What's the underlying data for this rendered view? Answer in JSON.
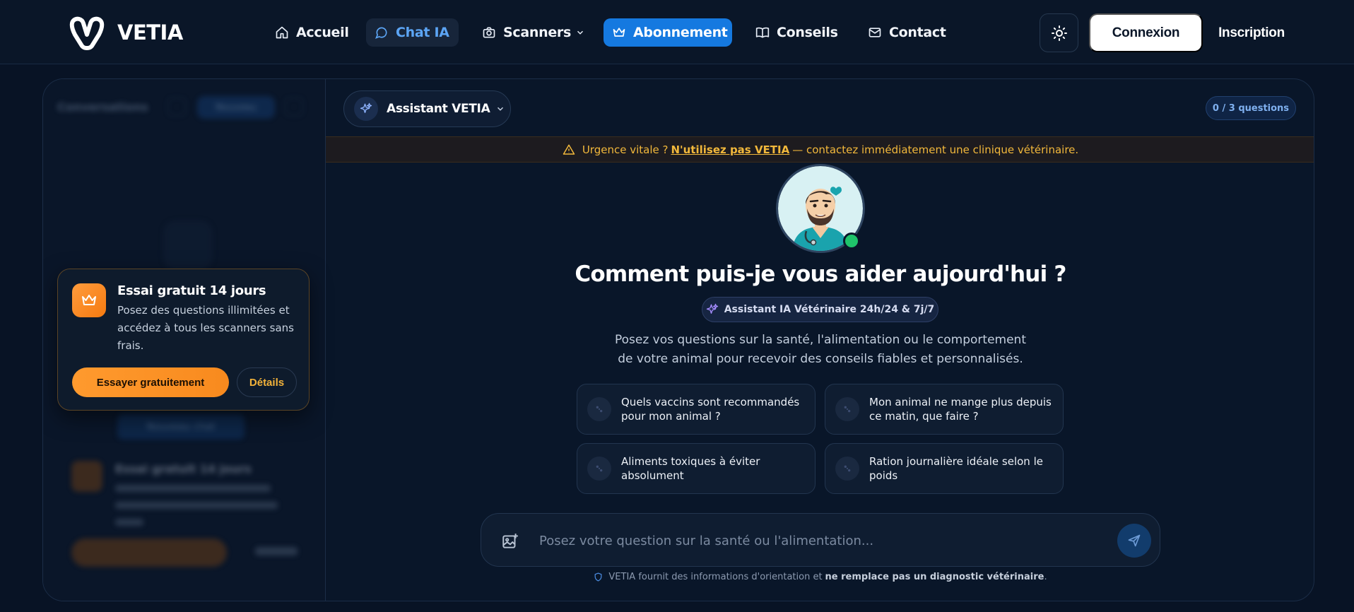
{
  "brand": {
    "name": "VETIA"
  },
  "nav": {
    "home": "Accueil",
    "chat": "Chat IA",
    "scanners": "Scanners",
    "subscription": "Abonnement",
    "tips": "Conseils",
    "contact": "Contact",
    "login": "Connexion",
    "signup": "Inscription"
  },
  "sidebar": {
    "title": "Conversations",
    "new_button": "Nouveau",
    "new_conversation": "Nouveau chat",
    "ghost_trial_title": "Essai gratuit 14 jours"
  },
  "trial": {
    "title": "Essai gratuit 14 jours",
    "description": "Posez des questions illimitées et accédez à tous les scanners sans frais.",
    "cta": "Essayer gratuitement",
    "details": "Détails"
  },
  "chat": {
    "assistant": "Assistant VETIA",
    "quota": "0 / 3 questions",
    "urgency_prefix": "Urgence vitale ?",
    "urgency_strong": "N'utilisez pas VETIA",
    "urgency_suffix": "— contactez immédiatement une clinique vétérinaire.",
    "headline": "Comment puis-je vous aider aujourd'hui ?",
    "badge": "Assistant IA Vétérinaire 24h/24 & 7j/7",
    "intro": "Posez vos questions sur la santé, l'alimentation ou le comportement de votre animal pour recevoir des conseils fiables et personnalisés.",
    "suggestions": [
      "Quels vaccins sont recommandés pour mon animal ?",
      "Mon animal ne mange plus depuis ce matin, que faire ?",
      "Aliments toxiques à éviter absolument",
      "Ration journalière idéale selon le poids"
    ],
    "input_placeholder": "Posez votre question sur la santé ou l'alimentation...",
    "disclaimer_prefix": "VETIA fournit des informations d'orientation et",
    "disclaimer_strong": "ne remplace pas un diagnostic vétérinaire",
    "disclaimer_suffix": "."
  },
  "colors": {
    "background": "#081325",
    "accent_blue": "#1579e0",
    "chat_active": "#5ca5f5",
    "warning": "#f2b83b",
    "trial_orange": "#ff9a2e",
    "online": "#1fc46a"
  },
  "icons": {
    "home": "home-icon",
    "chat": "chat-bubble-icon",
    "scanners": "camera-icon",
    "subscription": "crown-icon",
    "tips": "book-icon",
    "contact": "mail-icon",
    "theme": "sun-icon",
    "assistant": "sparkles-icon",
    "warning": "warning-icon",
    "attach": "image-add-icon",
    "send": "send-icon",
    "shield": "shield-icon",
    "paw": "paw-icon"
  }
}
